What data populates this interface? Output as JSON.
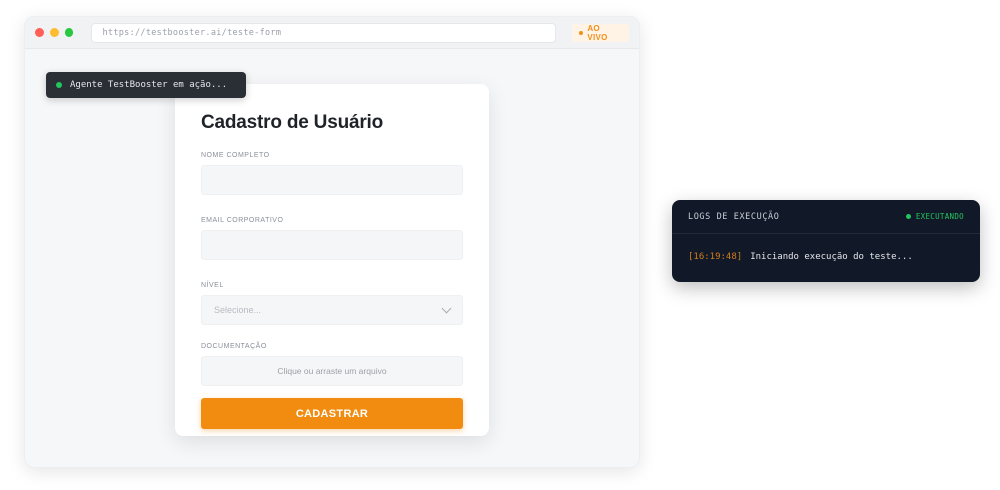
{
  "browser": {
    "url": "https://testbooster.ai/teste-form",
    "live_label": "AO VIVO"
  },
  "agent": {
    "status_text": "Agente TestBooster em ação..."
  },
  "form": {
    "title": "Cadastro de Usuário",
    "fields": {
      "name_label": "NOME COMPLETO",
      "email_label": "EMAIL CORPORATIVO",
      "role_label": "NÍVEL",
      "role_placeholder": "Selecione...",
      "doc_label": "DOCUMENTAÇÃO",
      "doc_placeholder": "Clique ou arraste um arquivo"
    },
    "submit_label": "CADASTRAR"
  },
  "logs": {
    "title": "LOGS DE EXECUÇÃO",
    "status": "EXECUTANDO",
    "entries": [
      {
        "time": "[16:19:48]",
        "message": "Iniciando execução do teste..."
      }
    ]
  },
  "colors": {
    "accent": "#f28c10",
    "status_green": "#22c55e",
    "logs_bg": "#111827"
  }
}
